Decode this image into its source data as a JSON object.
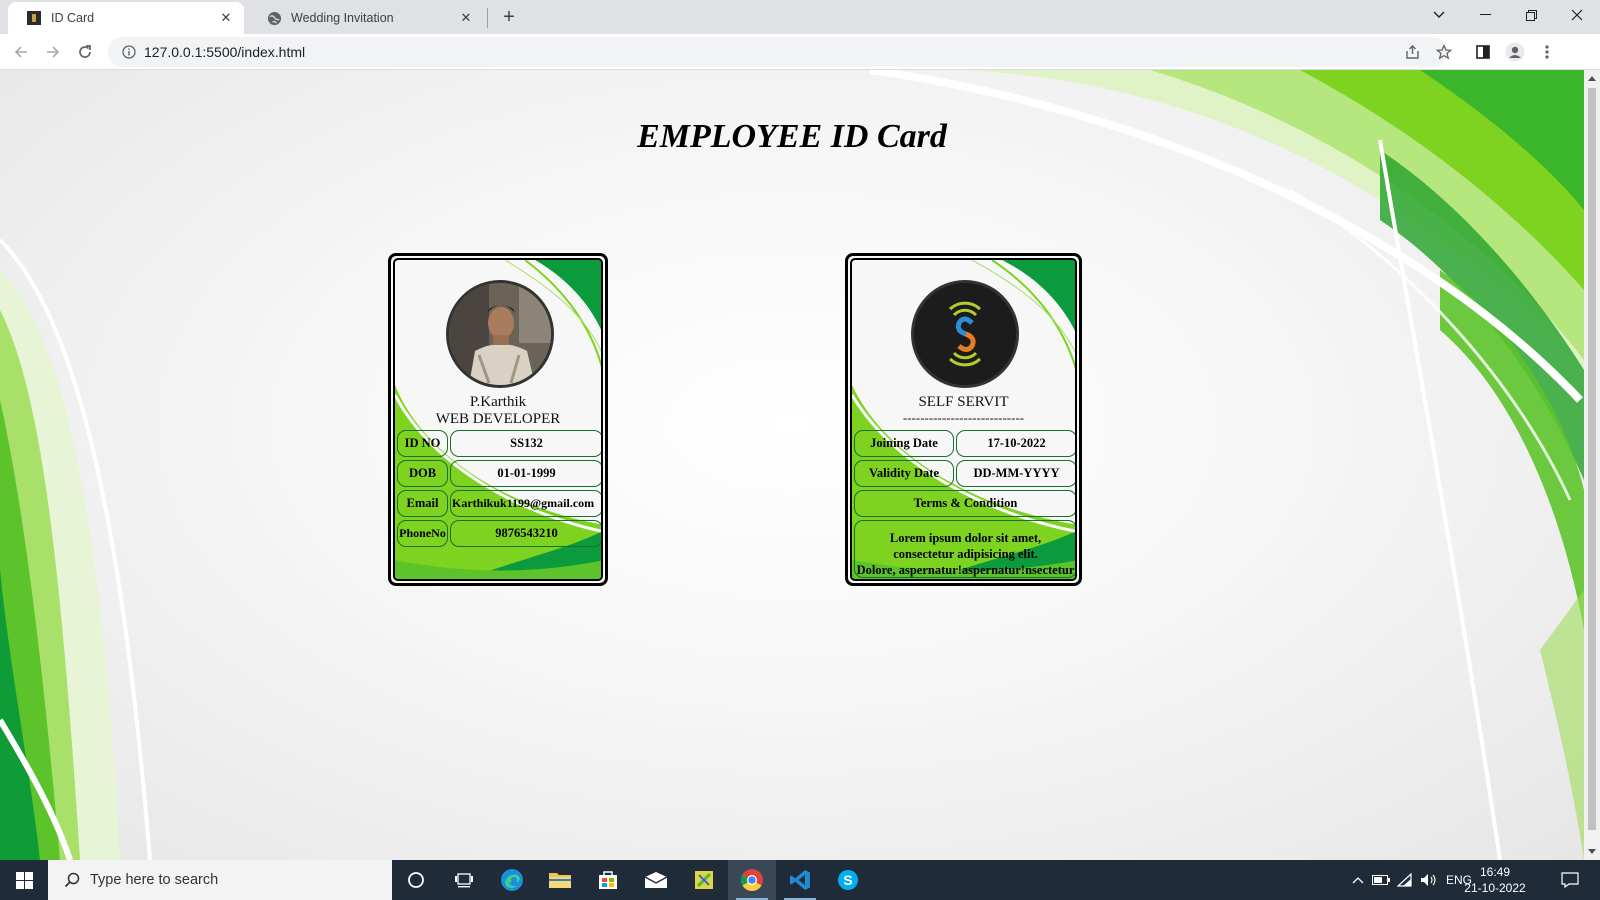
{
  "browser": {
    "tabs": [
      {
        "title": "ID Card",
        "active": true
      },
      {
        "title": "Wedding Invitation",
        "active": false
      }
    ],
    "url": "127.0.0.1:5500/index.html"
  },
  "page": {
    "title": "EMPLOYEE ID Card",
    "front_card": {
      "name": "P.Karthik",
      "role": "WEB DEVELOPER",
      "fields": [
        {
          "label": "ID NO",
          "value": "SS132"
        },
        {
          "label": "DOB",
          "value": "01-01-1999"
        },
        {
          "label": "Email",
          "value": "Karthikuk1199@gmail.com"
        },
        {
          "label": "PhoneNo",
          "value": "9876543210"
        }
      ]
    },
    "back_card": {
      "company": "SELF SERVIT",
      "divider": "----------------------------",
      "fields": [
        {
          "label": "Joining Date",
          "value": "17-10-2022"
        },
        {
          "label": "Validity Date",
          "value": "DD-MM-YYYY"
        }
      ],
      "terms_title": "Terms & Condition",
      "terms_lines": [
        "Lorem ipsum dolor sit amet,",
        "consectetur adipisicing elit.",
        "Dolore, aspernatur!aspernatur!nsectetur"
      ]
    }
  },
  "taskbar": {
    "search_placeholder": "Type here to search",
    "language": "ENG",
    "time": "16:49",
    "date": "21-10-2022"
  },
  "colors": {
    "green_dark": "#0b9a3c",
    "green_light": "#7ed321",
    "taskbar": "#1f2b38"
  }
}
